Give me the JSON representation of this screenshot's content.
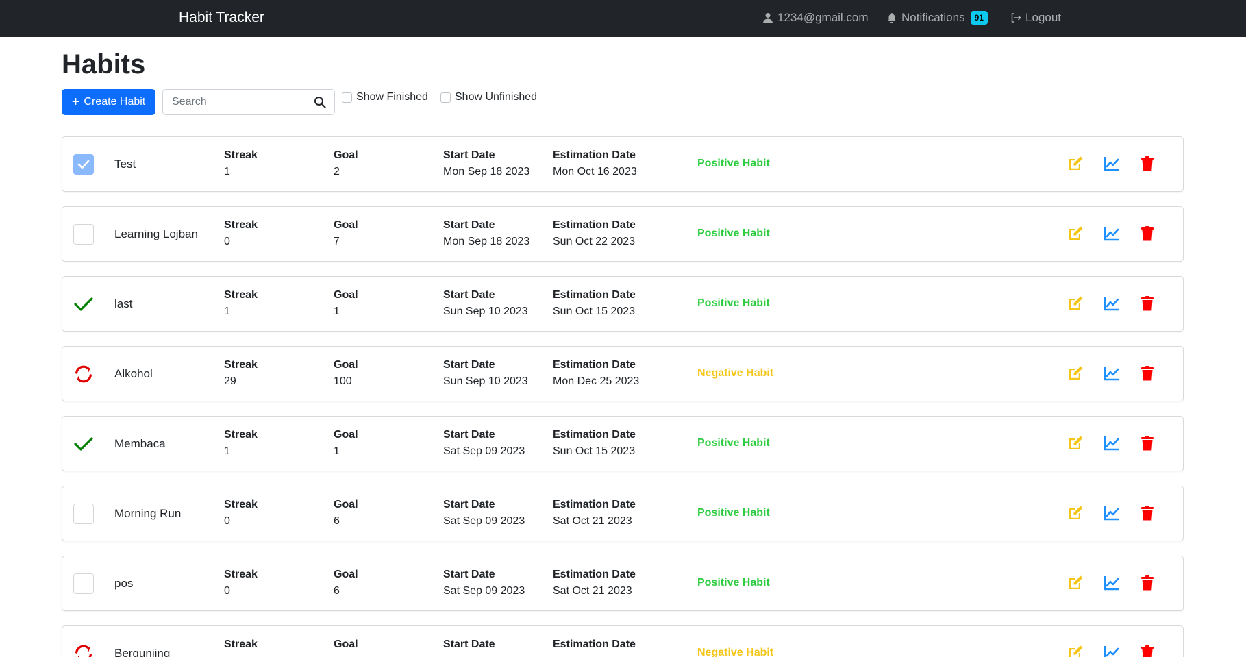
{
  "navbar": {
    "brand": "Habit Tracker",
    "user_email": "1234@gmail.com",
    "notifications_label": "Notifications",
    "notifications_count": "91",
    "logout_label": "Logout"
  },
  "page": {
    "title": "Habits",
    "create_button": "Create Habit",
    "search_placeholder": "Search",
    "filter_finished": "Show Finished",
    "filter_unfinished": "Show Unfinished"
  },
  "labels": {
    "streak": "Streak",
    "goal": "Goal",
    "start_date": "Start Date",
    "estimation_date": "Estimation Date"
  },
  "colors": {
    "positive": "#2ecc40",
    "negative": "#f5c518",
    "edit": "#f5c518",
    "stats": "#1e90ff",
    "delete": "#ff0000",
    "done": "#008000",
    "repeat": "#e00000",
    "primary": "#0d6efd"
  },
  "habits": [
    {
      "name": "Test",
      "status": "checked",
      "streak": "1",
      "goal": "2",
      "start_date": "Mon Sep 18 2023",
      "estimation_date": "Mon Oct 16 2023",
      "type": "Positive Habit"
    },
    {
      "name": "Learning Lojban",
      "status": "unchecked",
      "streak": "0",
      "goal": "7",
      "start_date": "Mon Sep 18 2023",
      "estimation_date": "Sun Oct 22 2023",
      "type": "Positive Habit"
    },
    {
      "name": "last",
      "status": "done",
      "streak": "1",
      "goal": "1",
      "start_date": "Sun Sep 10 2023",
      "estimation_date": "Sun Oct 15 2023",
      "type": "Positive Habit"
    },
    {
      "name": "Alkohol",
      "status": "repeat",
      "streak": "29",
      "goal": "100",
      "start_date": "Sun Sep 10 2023",
      "estimation_date": "Mon Dec 25 2023",
      "type": "Negative Habit"
    },
    {
      "name": "Membaca",
      "status": "done",
      "streak": "1",
      "goal": "1",
      "start_date": "Sat Sep 09 2023",
      "estimation_date": "Sun Oct 15 2023",
      "type": "Positive Habit"
    },
    {
      "name": "Morning Run",
      "status": "unchecked",
      "streak": "0",
      "goal": "6",
      "start_date": "Sat Sep 09 2023",
      "estimation_date": "Sat Oct 21 2023",
      "type": "Positive Habit"
    },
    {
      "name": "pos",
      "status": "unchecked",
      "streak": "0",
      "goal": "6",
      "start_date": "Sat Sep 09 2023",
      "estimation_date": "Sat Oct 21 2023",
      "type": "Positive Habit"
    },
    {
      "name": "Berguniing",
      "status": "repeat",
      "streak": "",
      "goal": "",
      "start_date": "",
      "estimation_date": "",
      "type": "Negative Habit"
    }
  ]
}
